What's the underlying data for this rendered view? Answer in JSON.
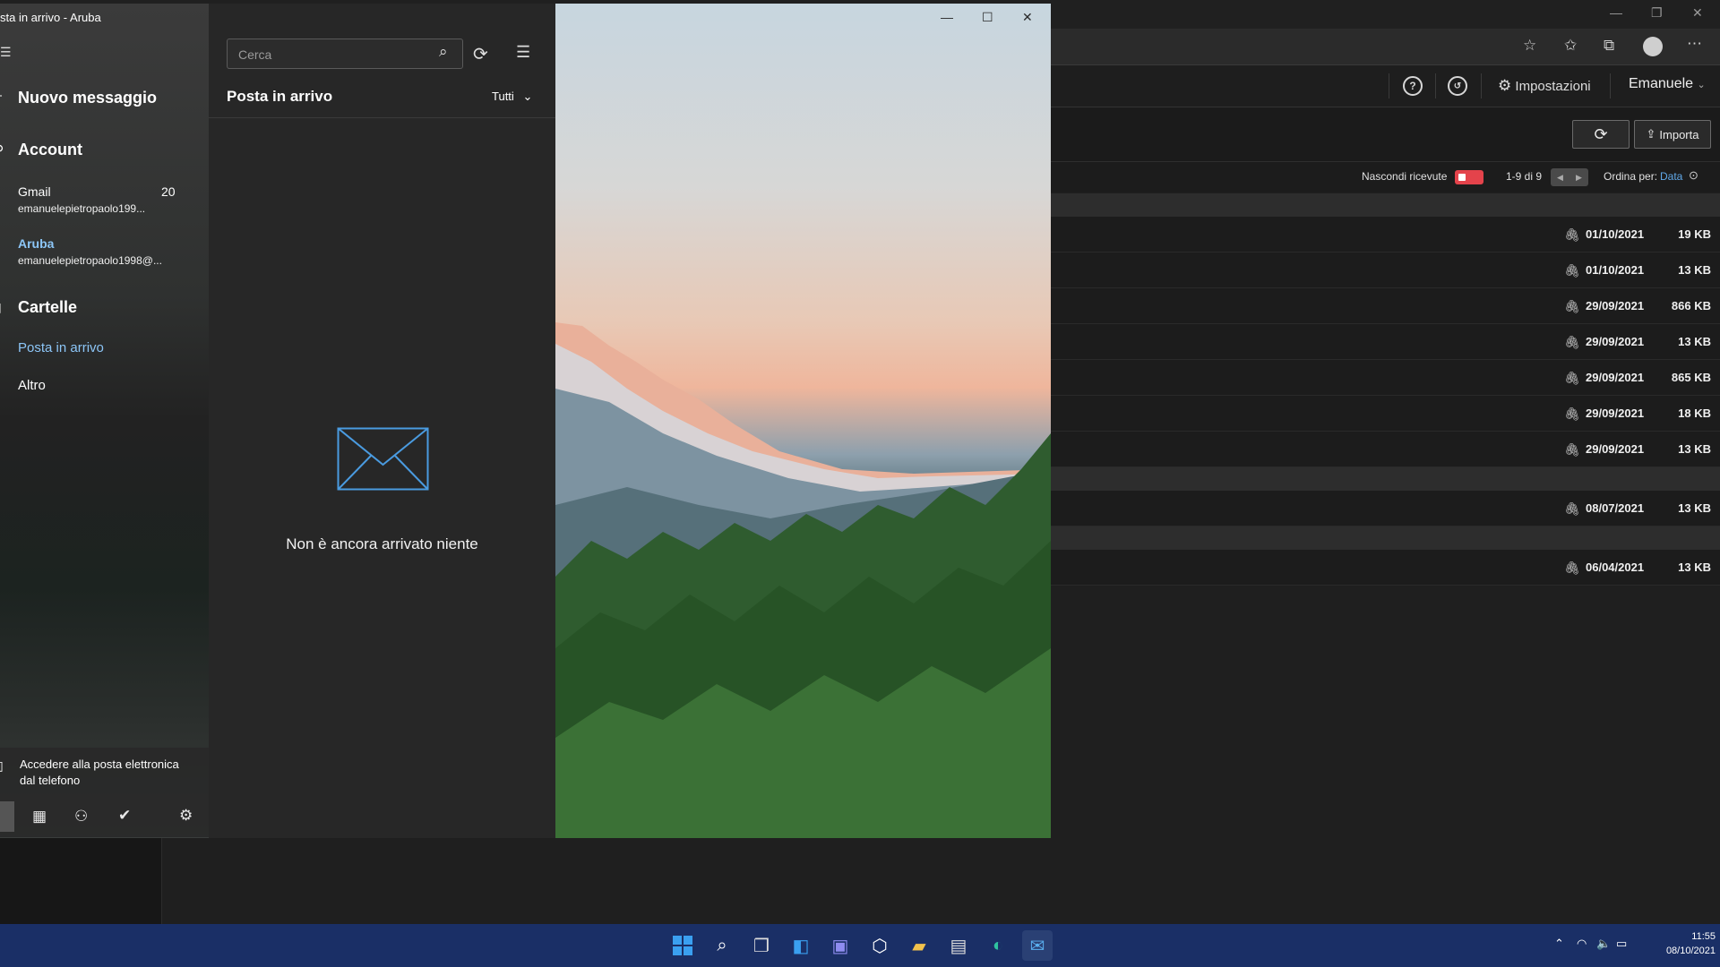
{
  "browser": {
    "window_controls": {
      "minimize": "—",
      "restore": "❐",
      "close": "✕"
    },
    "header": {
      "settings_label": "Impostazioni",
      "user_label": "Emanuele"
    },
    "actions": {
      "import_label": "Importa"
    },
    "filter": {
      "hide_received_label": "Nascondi ricevute",
      "page_range": "1-9 di 9",
      "sort_label": "Ordina per:",
      "sort_value": "Data"
    },
    "messages": [
      {
        "date": "01/10/2021",
        "size": "19 KB"
      },
      {
        "date": "01/10/2021",
        "size": "13 KB"
      },
      {
        "date": "29/09/2021",
        "size": "866 KB"
      },
      {
        "date": "29/09/2021",
        "size": "13 KB"
      },
      {
        "date": "29/09/2021",
        "size": "865 KB"
      },
      {
        "date": "29/09/2021",
        "size": "18 KB"
      },
      {
        "date": "29/09/2021",
        "size": "13 KB"
      },
      {
        "date": "08/07/2021",
        "size": "13 KB"
      },
      {
        "date": "06/04/2021",
        "size": "13 KB"
      }
    ]
  },
  "mail": {
    "window_title": "sta in arrivo - Aruba",
    "nav": {
      "new_message": "Nuovo messaggio",
      "accounts_heading": "Account",
      "accounts": [
        {
          "name": "Gmail",
          "email": "emanuelepietropaolo199...",
          "count": "20"
        },
        {
          "name": "Aruba",
          "email": "emanuelepietropaolo1998@...",
          "count": ""
        }
      ],
      "folders_heading": "Cartelle",
      "folders": [
        {
          "label": "Posta in arrivo",
          "selected": true
        },
        {
          "label": "Altro",
          "selected": false
        }
      ],
      "phone_prompt_line1": "Accedere alla posta elettronica",
      "phone_prompt_line2": "dal telefono"
    },
    "list": {
      "search_placeholder": "Cerca",
      "title": "Posta in arrivo",
      "filter_label": "Tutti",
      "empty_text": "Non è ancora arrivato niente"
    },
    "reading_pane": {
      "window_controls": {
        "minimize": "—",
        "maximize": "☐",
        "close": "✕"
      }
    }
  },
  "taskbar": {
    "time": "11:55",
    "date": "08/10/2021"
  },
  "colors": {
    "accent": "#60a8e8",
    "toggle_on": "#e4434b",
    "taskbar": "#1a2f66"
  }
}
